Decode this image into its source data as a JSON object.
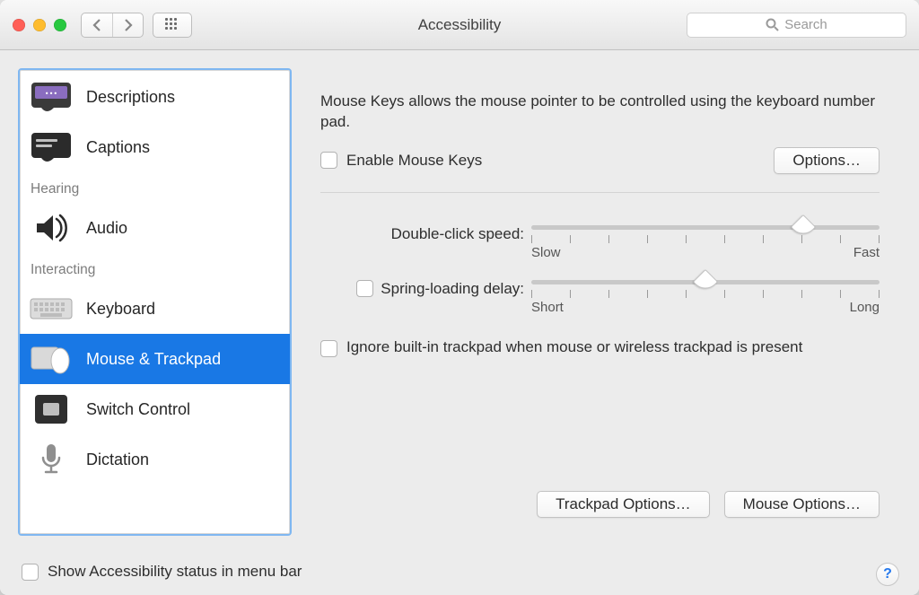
{
  "window": {
    "title": "Accessibility",
    "search_placeholder": "Search"
  },
  "sidebar": {
    "sections": [
      {
        "heading": null,
        "items": [
          {
            "id": "descriptions",
            "label": "Descriptions",
            "icon": "descriptions-icon",
            "selected": false
          },
          {
            "id": "captions",
            "label": "Captions",
            "icon": "captions-icon",
            "selected": false
          }
        ]
      },
      {
        "heading": "Hearing",
        "items": [
          {
            "id": "audio",
            "label": "Audio",
            "icon": "speaker-icon",
            "selected": false
          }
        ]
      },
      {
        "heading": "Interacting",
        "items": [
          {
            "id": "keyboard",
            "label": "Keyboard",
            "icon": "keyboard-icon",
            "selected": false
          },
          {
            "id": "mouse-trackpad",
            "label": "Mouse & Trackpad",
            "icon": "mouse-icon",
            "selected": true
          },
          {
            "id": "switch-control",
            "label": "Switch Control",
            "icon": "switch-icon",
            "selected": false
          },
          {
            "id": "dictation",
            "label": "Dictation",
            "icon": "mic-icon",
            "selected": false
          }
        ]
      }
    ]
  },
  "panel": {
    "description": "Mouse Keys allows the mouse pointer to be controlled using the keyboard number pad.",
    "enable_mouse_keys": {
      "label": "Enable Mouse Keys",
      "checked": false,
      "options_button": "Options…"
    },
    "double_click": {
      "label": "Double-click speed:",
      "min_label": "Slow",
      "max_label": "Fast",
      "value_percent": 78,
      "ticks": 10
    },
    "spring_loading": {
      "label": "Spring-loading delay:",
      "checked": false,
      "min_label": "Short",
      "max_label": "Long",
      "value_percent": 50,
      "ticks": 10
    },
    "ignore_trackpad": {
      "label": "Ignore built-in trackpad when mouse or wireless trackpad is present",
      "checked": false
    },
    "buttons": {
      "trackpad_options": "Trackpad Options…",
      "mouse_options": "Mouse Options…"
    }
  },
  "footer": {
    "show_status_label": "Show Accessibility status in menu bar",
    "show_status_checked": false,
    "help": "?"
  }
}
